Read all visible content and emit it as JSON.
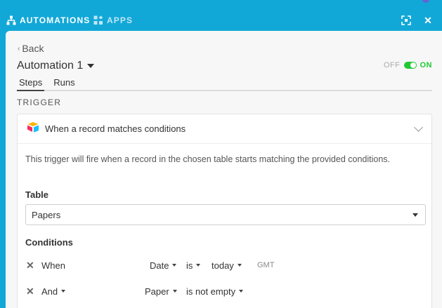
{
  "header": {
    "tab_automations": "AUTOMATIONS",
    "tab_apps": "APPS"
  },
  "panel": {
    "back_label": "Back",
    "automation_name": "Automation 1",
    "toggle": {
      "off_label": "OFF",
      "on_label": "ON",
      "state": "on"
    },
    "tabs": [
      {
        "label": "Steps",
        "selected": true
      },
      {
        "label": "Runs",
        "selected": false
      }
    ],
    "section_title": "TRIGGER"
  },
  "trigger": {
    "title": "When a record matches conditions",
    "description": "This trigger will fire when a record in the chosen table starts matching the provided conditions.",
    "table_label": "Table",
    "table_value": "Papers",
    "conditions_label": "Conditions",
    "conditions": [
      {
        "conjunction": "When",
        "field": "Date",
        "operator": "is",
        "value": "today",
        "note": "GMT"
      },
      {
        "conjunction": "And",
        "field": "Paper",
        "operator": "is not empty"
      }
    ]
  },
  "colors": {
    "header_bg": "#11a8d8",
    "toggle_on": "#20c933",
    "panel_bg": "#f7f7f7"
  }
}
